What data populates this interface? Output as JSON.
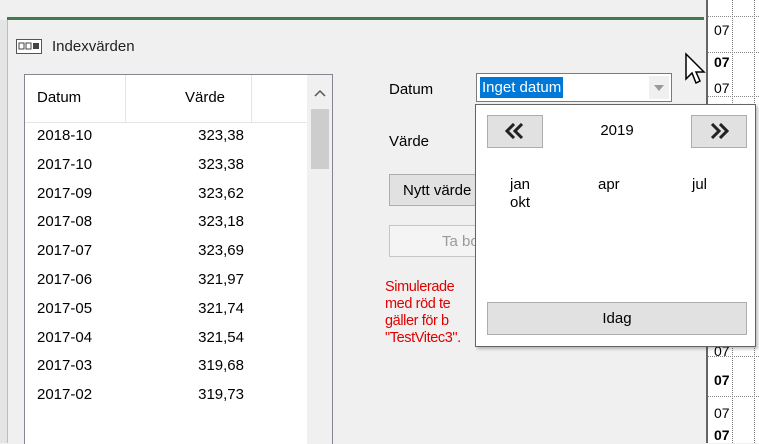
{
  "window": {
    "title": "Indexvärden",
    "icon": "table-icon"
  },
  "list": {
    "columns": [
      "Datum",
      "Värde"
    ],
    "rows": [
      {
        "date": "2018-10",
        "value": "323,38"
      },
      {
        "date": "2017-10",
        "value": "323,38"
      },
      {
        "date": "2017-09",
        "value": "323,62"
      },
      {
        "date": "2017-08",
        "value": "323,18"
      },
      {
        "date": "2017-07",
        "value": "323,69"
      },
      {
        "date": "2017-06",
        "value": "321,97"
      },
      {
        "date": "2017-05",
        "value": "321,74"
      },
      {
        "date": "2017-04",
        "value": "321,54"
      },
      {
        "date": "2017-03",
        "value": "319,68"
      },
      {
        "date": "2017-02",
        "value": "319,73"
      }
    ],
    "scroll_up_icon": "chevron-up-icon"
  },
  "form": {
    "date_label": "Datum",
    "date_value": "Inget datum",
    "dropdown_icon": "dropdown-arrow-icon",
    "value_label": "Värde",
    "new_value_button": "Nytt värde",
    "take_button": "Ta bort",
    "note_lines": [
      "Simulerade",
      "med röd te",
      "gäller för b",
      "\"TestVitec3\"."
    ]
  },
  "calendar": {
    "prev_icon": "double-chevron-left-icon",
    "next_icon": "double-chevron-right-icon",
    "prev_label": "«",
    "next_label": "»",
    "year": "2019",
    "months": [
      "jan",
      "apr",
      "jul",
      "okt"
    ],
    "today_button": "Idag"
  },
  "background_grid": {
    "cells": [
      "07",
      "07",
      "07",
      "07",
      "07",
      "07",
      "07"
    ]
  },
  "colors": {
    "accent_line": "#3f7b4d",
    "selection": "#0078d7",
    "note_text": "#e00000"
  }
}
